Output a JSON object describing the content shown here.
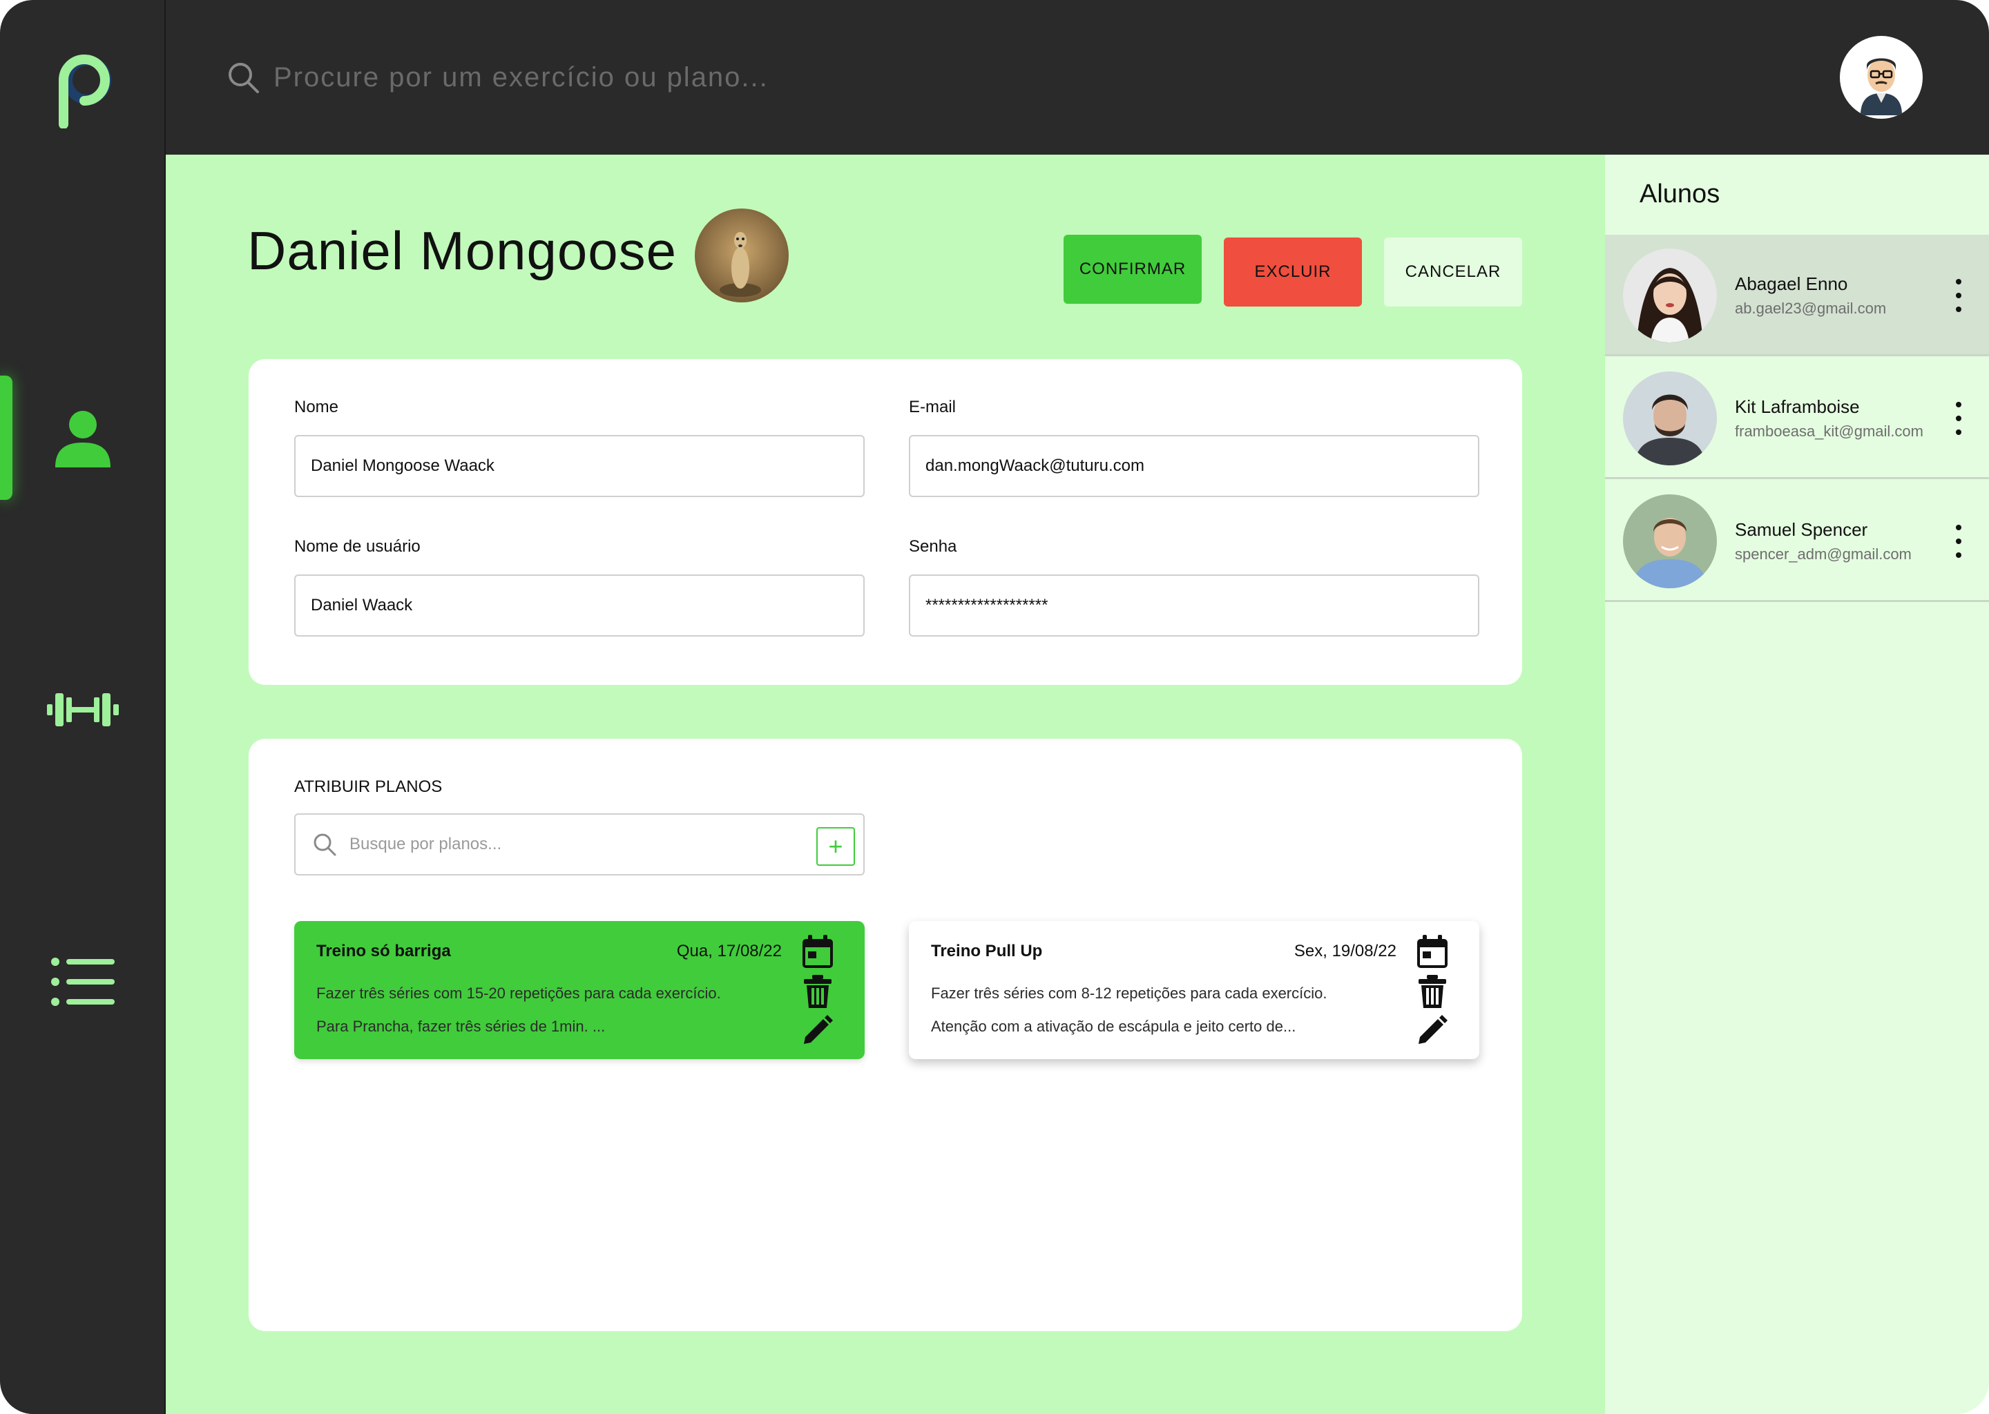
{
  "colors": {
    "accent_green": "#41cc3b",
    "danger_red": "#f04e3e",
    "background_green": "#c2fabb",
    "dark_chrome": "#2a2a2a",
    "panel_light": "#e4fde0"
  },
  "topbar": {
    "search_placeholder": "Procure por um exercício ou plano..."
  },
  "sidebar": {
    "items": [
      {
        "icon": "user-icon",
        "active": true
      },
      {
        "icon": "dumbbell-icon",
        "active": false
      },
      {
        "icon": "list-icon",
        "active": false
      }
    ]
  },
  "profile": {
    "title": "Daniel Mongoose"
  },
  "actions": {
    "confirm": "CONFIRMAR",
    "delete": "EXCLUIR",
    "cancel": "CANCELAR"
  },
  "form": {
    "name_label": "Nome",
    "name_value": "Daniel Mongoose Waack",
    "email_label": "E-mail",
    "email_value": "dan.mongWaack@tuturu.com",
    "username_label": "Nome de usuário",
    "username_value": "Daniel Waack",
    "password_label": "Senha",
    "password_value": "*******************"
  },
  "plans": {
    "section_title": "ATRIBUIR PLANOS",
    "search_placeholder": "Busque por planos...",
    "add_label": "+",
    "items": [
      {
        "title": "Treino só barriga",
        "date": "Qua, 17/08/22",
        "line1": "Fazer três séries com 15-20 repetições para cada exercício.",
        "line2": "Para Prancha, fazer três séries de 1min.   ..."
      },
      {
        "title": "Treino Pull Up",
        "date": "Sex, 19/08/22",
        "line1": "Fazer três séries com 8-12 repetições para cada exercício.",
        "line2": "Atenção com a ativação de escápula e jeito certo de..."
      }
    ]
  },
  "students": {
    "title": "Alunos",
    "items": [
      {
        "name": "Abagael Enno",
        "email": "ab.gael23@gmail.com"
      },
      {
        "name": "Kit Laframboise",
        "email": "framboeasa_kit@gmail.com"
      },
      {
        "name": "Samuel Spencer",
        "email": "spencer_adm@gmail.com"
      }
    ]
  }
}
